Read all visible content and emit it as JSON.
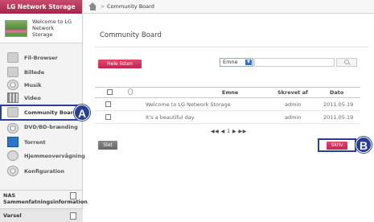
{
  "sidebar": {
    "brand": "LG Network Storage",
    "welcome": "Welcome to LG Network Storage",
    "items": [
      {
        "label": "Fil-Browser",
        "icon": "file-browser-icon"
      },
      {
        "label": "Billede",
        "icon": "photo-icon"
      },
      {
        "label": "Musik",
        "icon": "music-icon"
      },
      {
        "label": "Video",
        "icon": "video-icon"
      },
      {
        "label": "Community Board",
        "icon": "community-board-icon",
        "active": true
      },
      {
        "label": "DVD/BD-brænding",
        "icon": "disc-icon"
      },
      {
        "label": "Torrent",
        "icon": "torrent-icon"
      },
      {
        "label": "Hjemmeovervågning",
        "icon": "home-monitoring-icon"
      },
      {
        "label": "Konfiguration",
        "icon": "settings-icon"
      }
    ],
    "nas_label": "NAS Sammenfatningsinformation",
    "varsel_label": "Varsel"
  },
  "topbar": {
    "crumb": "Community Board",
    "separator": ">"
  },
  "main": {
    "title": "Community Board",
    "all_list_label": "Hele listen",
    "search": {
      "select_value": "Emne",
      "value": ""
    },
    "table": {
      "headers": {
        "subject": "Emne",
        "author": "Skrevet af",
        "date": "Dato"
      },
      "rows": [
        {
          "subject": "Welcome to LG Network Storage",
          "author": "admin",
          "date": "2011.05.19"
        },
        {
          "subject": "It's a beautiful day",
          "author": "admin",
          "date": "2011.05.19"
        }
      ]
    },
    "pager": {
      "first": "◀◀",
      "prev": "◀",
      "page": "1",
      "next": "▶",
      "last": "▶▶"
    },
    "delete_label": "Slet",
    "write_label": "Skriv"
  },
  "callouts": {
    "a": "A",
    "b": "B"
  },
  "colors": {
    "brand": "#b3305a",
    "button": "#d63560",
    "callout": "#2a3f93"
  }
}
